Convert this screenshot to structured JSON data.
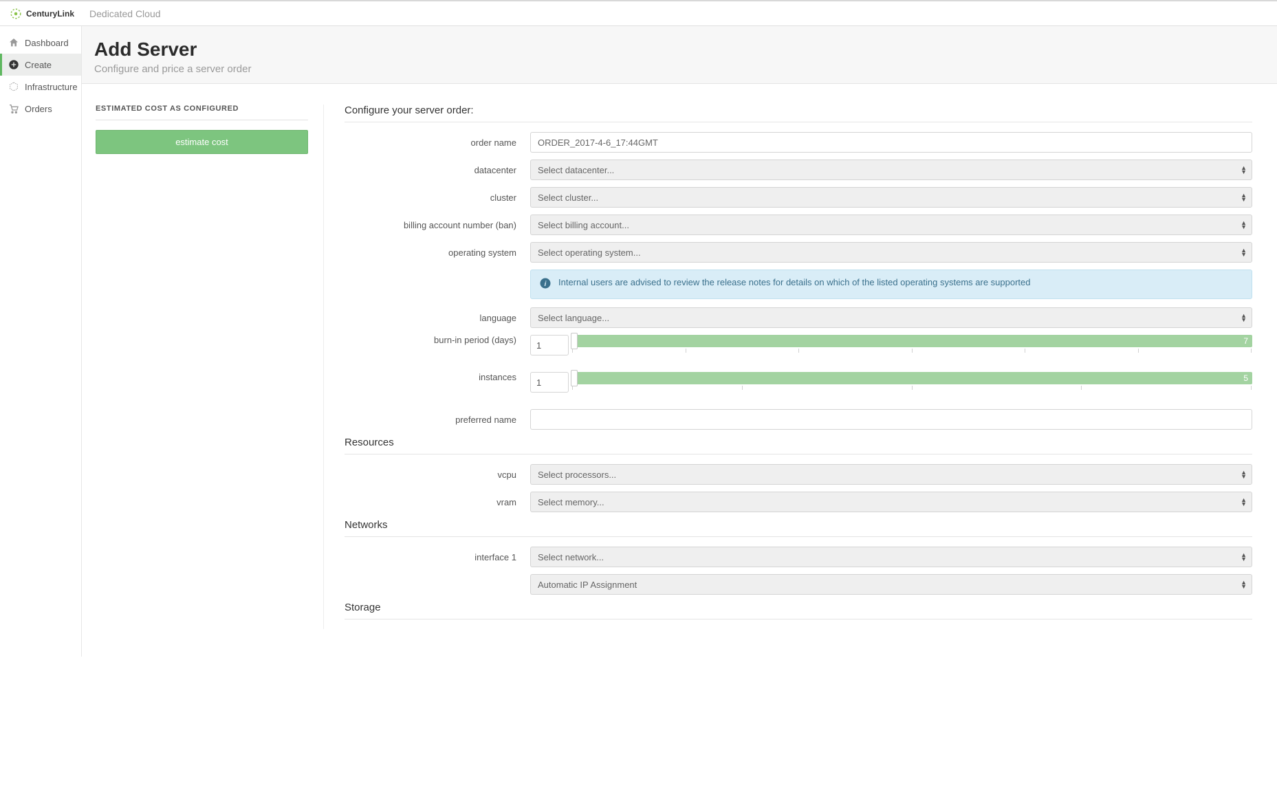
{
  "brand": {
    "name": "CenturyLink",
    "app": "Dedicated Cloud"
  },
  "nav": {
    "items": [
      {
        "label": "Dashboard"
      },
      {
        "label": "Create"
      },
      {
        "label": "Infrastructure"
      },
      {
        "label": "Orders"
      }
    ]
  },
  "header": {
    "title": "Add Server",
    "subtitle": "Configure and price a server order"
  },
  "cost": {
    "heading": "ESTIMATED COST AS CONFIGURED",
    "button": "estimate cost"
  },
  "form": {
    "configure_title": "Configure your server order:",
    "order_name": {
      "label": "order name",
      "value": "ORDER_2017-4-6_17:44GMT"
    },
    "datacenter": {
      "label": "datacenter",
      "placeholder": "Select datacenter..."
    },
    "cluster": {
      "label": "cluster",
      "placeholder": "Select cluster..."
    },
    "ban": {
      "label": "billing account number (ban)",
      "placeholder": "Select billing account..."
    },
    "os": {
      "label": "operating system",
      "placeholder": "Select operating system..."
    },
    "os_info": "Internal users are advised to review the release notes for details on which of the listed operating systems are supported",
    "language": {
      "label": "language",
      "placeholder": "Select language..."
    },
    "burn_in": {
      "label": "burn-in period (days)",
      "value": "1",
      "max": "7",
      "ticks": 7
    },
    "instances": {
      "label": "instances",
      "value": "1",
      "max": "5",
      "ticks": 5
    },
    "preferred_name": {
      "label": "preferred name",
      "value": ""
    },
    "resources_title": "Resources",
    "vcpu": {
      "label": "vcpu",
      "placeholder": "Select processors..."
    },
    "vram": {
      "label": "vram",
      "placeholder": "Select memory..."
    },
    "networks_title": "Networks",
    "interface1": {
      "label": "interface 1",
      "placeholder": "Select network..."
    },
    "ip_assign": {
      "placeholder": "Automatic IP Assignment"
    },
    "storage_title": "Storage"
  }
}
